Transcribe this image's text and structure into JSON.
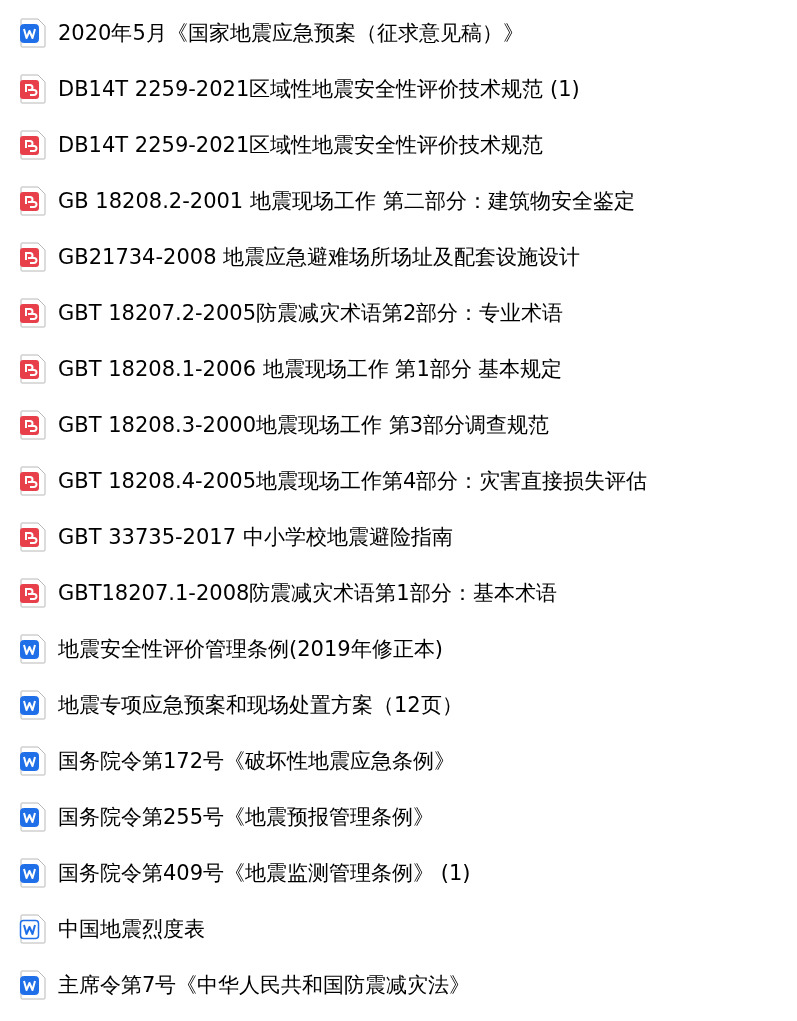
{
  "files": [
    {
      "kind": "docx",
      "name": "2020年5月《国家地震应急预案（征求意见稿）》"
    },
    {
      "kind": "pdf",
      "name": "DB14T 2259-2021区域性地震安全性评价技术规范 (1)"
    },
    {
      "kind": "pdf",
      "name": "DB14T 2259-2021区域性地震安全性评价技术规范"
    },
    {
      "kind": "pdf",
      "name": "GB 18208.2-2001 地震现场工作 第二部分：建筑物安全鉴定"
    },
    {
      "kind": "pdf",
      "name": "GB21734-2008 地震应急避难场所场址及配套设施设计"
    },
    {
      "kind": "pdf",
      "name": "GBT 18207.2-2005防震减灾术语第2部分：专业术语"
    },
    {
      "kind": "pdf",
      "name": "GBT 18208.1-2006 地震现场工作 第1部分 基本规定"
    },
    {
      "kind": "pdf",
      "name": "GBT 18208.3-2000地震现场工作 第3部分调查规范"
    },
    {
      "kind": "pdf",
      "name": "GBT 18208.4-2005地震现场工作第4部分：灾害直接损失评估"
    },
    {
      "kind": "pdf",
      "name": "GBT 33735-2017 中小学校地震避险指南"
    },
    {
      "kind": "pdf",
      "name": "GBT18207.1-2008防震减灾术语第1部分：基本术语"
    },
    {
      "kind": "docx",
      "name": "地震安全性评价管理条例(2019年修正本)"
    },
    {
      "kind": "docx",
      "name": "地震专项应急预案和现场处置方案（12页）"
    },
    {
      "kind": "docx",
      "name": "国务院令第172号《破坏性地震应急条例》"
    },
    {
      "kind": "docx",
      "name": "国务院令第255号《地震预报管理条例》"
    },
    {
      "kind": "docx",
      "name": "国务院令第409号《地震监测管理条例》 (1)"
    },
    {
      "kind": "doc",
      "name": "中国地震烈度表"
    },
    {
      "kind": "docx",
      "name": "主席令第7号《中华人民共和国防震减灾法》"
    }
  ]
}
